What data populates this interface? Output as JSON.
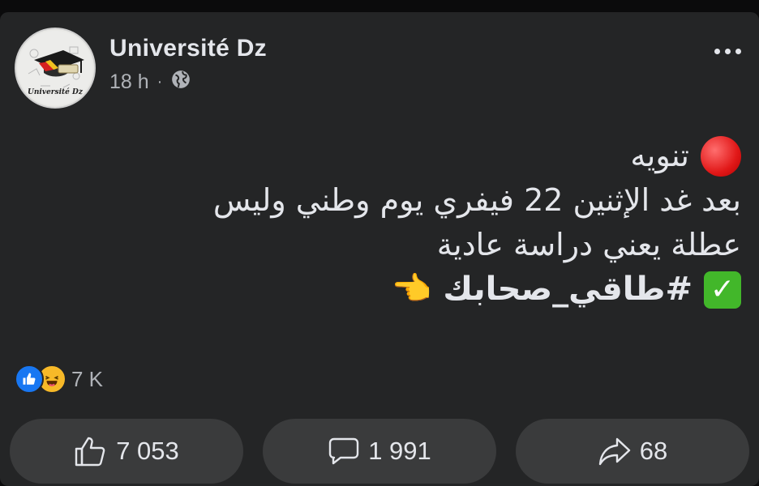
{
  "post": {
    "author": "Université Dz",
    "time": "18 h",
    "separator": "·",
    "privacy_icon": "globe-icon",
    "line1": "تنويه",
    "line2": "بعد غد الإثنين 22 فيفري يوم وطني وليس",
    "line3": "عطلة يعني دراسة عادية",
    "hashtag": "#طاقي_صحابك",
    "avatar_text": "Université Dz"
  },
  "reactions": {
    "count": "7 K",
    "icons": [
      "like-icon",
      "haha-icon"
    ]
  },
  "actions": {
    "like_count": "7 053",
    "comment_count": "1 991",
    "share_count": "68"
  },
  "colors": {
    "card_bg": "#242526",
    "button_bg": "#3a3b3c",
    "text": "#e4e6eb",
    "muted": "#b0b3b8",
    "like_blue": "#1877f2"
  }
}
